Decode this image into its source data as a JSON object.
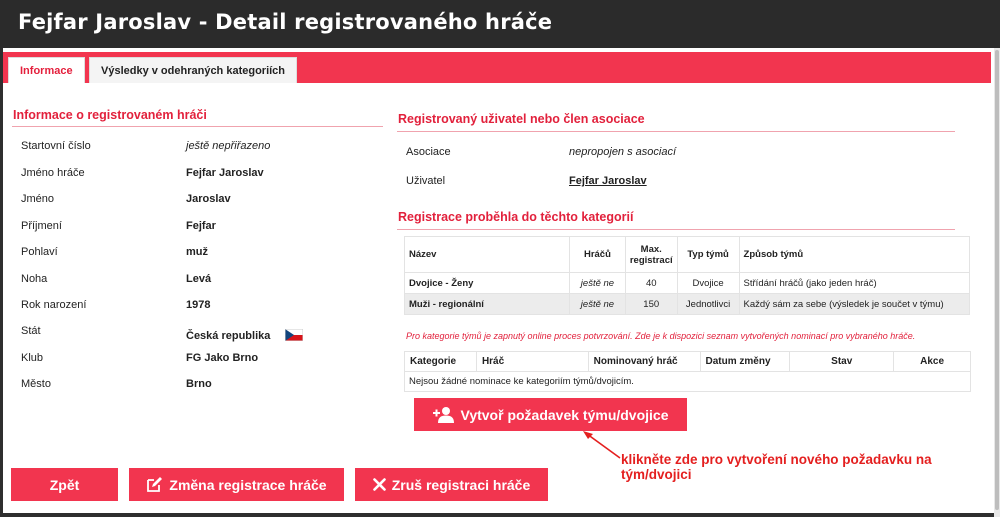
{
  "window": {
    "title": "Fejfar Jaroslav - Detail registrovaného hráče"
  },
  "tabs": [
    {
      "label": "Informace",
      "active": true
    },
    {
      "label": "Výsledky v odehraných kategoriích",
      "active": false
    }
  ],
  "player": {
    "section_title": "Informace o registrovaném hráči",
    "fields": [
      {
        "label": "Startovní číslo",
        "value": "ještě nepřiřazeno"
      },
      {
        "label": "Jméno hráče",
        "value": "Fejfar Jaroslav"
      },
      {
        "label": "Jméno",
        "value": "Jaroslav"
      },
      {
        "label": "Příjmení",
        "value": "Fejfar"
      },
      {
        "label": "Pohlaví",
        "value": "muž"
      },
      {
        "label": "Noha",
        "value": "Levá"
      },
      {
        "label": "Rok narození",
        "value": "1978"
      },
      {
        "label": "Stát",
        "value": "Česká republika",
        "icon": "czech-flag-icon"
      },
      {
        "label": "Klub",
        "value": "FG Jako Brno"
      },
      {
        "label": "Město",
        "value": "Brno"
      }
    ]
  },
  "user": {
    "section_title": "Registrovaný uživatel nebo člen asociace",
    "association_label": "Asociace",
    "association_value": "nepropojen s asociací",
    "user_label": "Uživatel",
    "user_value": "Fejfar Jaroslav"
  },
  "categories": {
    "section_title": "Registrace proběhla do těchto kategorií",
    "headers": [
      "Název",
      "Hráčů",
      "Max.",
      "registrací",
      "Typ týmů",
      "Způsob týmů"
    ],
    "rows": [
      {
        "name": "Dvojice - Ženy",
        "players": "ještě ne",
        "max": "40",
        "type": "Dvojice",
        "mode": "Střídání hráčů (jako jeden hráč)"
      },
      {
        "name": "Muži - regionální",
        "players": "ještě ne",
        "max": "150",
        "type": "Jednotlivci",
        "mode": "Každý sám za sebe (výsledek je součet v týmu)"
      }
    ],
    "note": "Pro kategorie týmů je zapnutý online proces potvrzování. Zde je k dispozici seznam vytvořených nominací pro vybraného hráče."
  },
  "nominations": {
    "headers": [
      "Kategorie",
      "Hráč",
      "Nominovaný hráč",
      "Datum změny",
      "Stav",
      "Akce"
    ],
    "empty": "Nejsou žádné nominace ke kategoriím týmů/dvojicím."
  },
  "buttons": {
    "create_team": "Vytvoř požadavek týmu/dvojice",
    "back": "Zpět",
    "change": "Změna registrace hráče",
    "cancel": "Zruš registraci hráče"
  },
  "hint": "klikněte zde pro vytvoření nového požadavku na tým/dvojici",
  "colors": {
    "accent": "#f2354f",
    "titlebar": "#2b2b2b",
    "hint": "#e41f1f"
  }
}
